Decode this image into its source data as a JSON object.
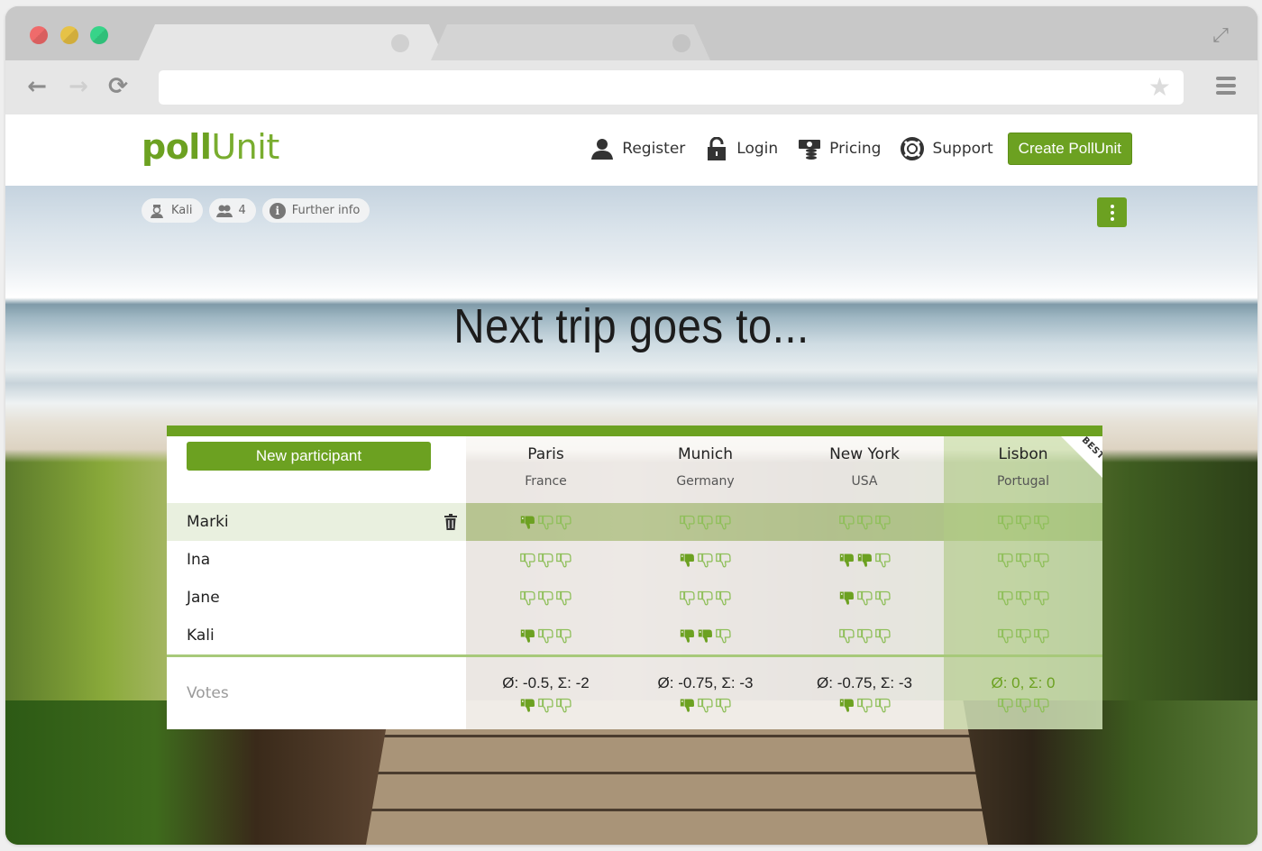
{
  "browser": {
    "nav": {
      "back": "←",
      "forward": "→",
      "reload": "⟳"
    },
    "url": "",
    "star": "★",
    "fullscreen": "⤢"
  },
  "site": {
    "logo_bold": "poll",
    "logo_light": "Unit",
    "nav": [
      {
        "label": "Register",
        "icon": "user-icon"
      },
      {
        "label": "Login",
        "icon": "lock-icon"
      },
      {
        "label": "Pricing",
        "icon": "money-icon"
      },
      {
        "label": "Support",
        "icon": "lifebuoy-icon"
      }
    ],
    "create_button": "Create PollUnit",
    "brand_color": "#6ca121"
  },
  "poll": {
    "pills": [
      {
        "label": "Kali",
        "icon": "owner-icon"
      },
      {
        "label": "4",
        "icon": "participants-icon"
      },
      {
        "label": "Further info",
        "icon": "info-icon"
      }
    ],
    "title": "Next trip goes to...",
    "new_participant_label": "New participant",
    "best_label": "BEST",
    "votes_label": "Votes",
    "options": [
      {
        "city": "Paris",
        "country": "France",
        "summary": "Ø: -0.5, Σ: -2",
        "sum_thumbs": 1,
        "best": false
      },
      {
        "city": "Munich",
        "country": "Germany",
        "summary": "Ø: -0.75, Σ: -3",
        "sum_thumbs": 1,
        "best": false
      },
      {
        "city": "New York",
        "country": "USA",
        "summary": "Ø: -0.75, Σ: -3",
        "sum_thumbs": 1,
        "best": false
      },
      {
        "city": "Lisbon",
        "country": "Portugal",
        "summary": "Ø: 0, Σ: 0",
        "sum_thumbs": 0,
        "best": true
      }
    ],
    "max_thumbs": 3,
    "participants": [
      {
        "name": "Marki",
        "highlighted": true,
        "votes": [
          1,
          0,
          0,
          0
        ]
      },
      {
        "name": "Ina",
        "highlighted": false,
        "votes": [
          0,
          1,
          2,
          0
        ]
      },
      {
        "name": "Jane",
        "highlighted": false,
        "votes": [
          0,
          0,
          1,
          0
        ]
      },
      {
        "name": "Kali",
        "highlighted": false,
        "votes": [
          1,
          2,
          0,
          0
        ]
      }
    ]
  }
}
